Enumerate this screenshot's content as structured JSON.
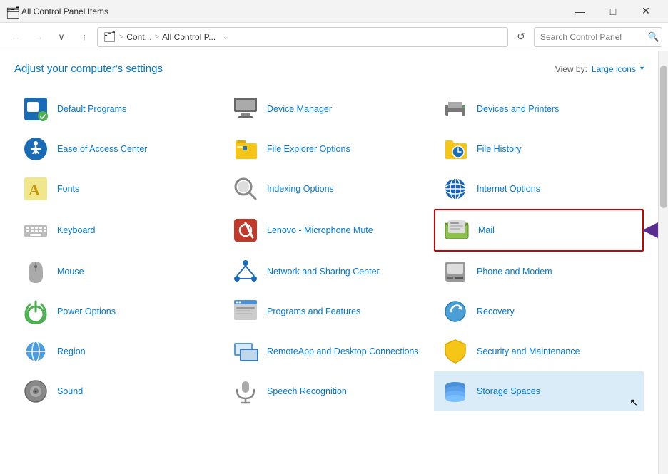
{
  "titlebar": {
    "title": "All Control Panel Items",
    "icon": "📋",
    "min_btn": "—",
    "max_btn": "□",
    "close_btn": "✕"
  },
  "addressbar": {
    "back_btn": "←",
    "forward_btn": "→",
    "dropdown_btn": "∨",
    "up_btn": "↑",
    "breadcrumb_1": "Cont...",
    "breadcrumb_2": "All Control P...",
    "dropdown_chevron": "⌄",
    "refresh": "↺",
    "search_placeholder": "Search Control Panel"
  },
  "header": {
    "title": "Adjust your computer's settings",
    "view_by_label": "View by:",
    "view_by_value": "Large icons",
    "view_by_arrow": "▾"
  },
  "items": [
    {
      "id": "default-programs",
      "label": "Default Programs",
      "icon": "default_programs"
    },
    {
      "id": "device-manager",
      "label": "Device Manager",
      "icon": "device_manager"
    },
    {
      "id": "devices-and-printers",
      "label": "Devices and Printers",
      "icon": "devices_printers"
    },
    {
      "id": "ease-of-access",
      "label": "Ease of Access Center",
      "icon": "ease_access"
    },
    {
      "id": "file-explorer-options",
      "label": "File Explorer Options",
      "icon": "file_explorer"
    },
    {
      "id": "file-history",
      "label": "File History",
      "icon": "file_history"
    },
    {
      "id": "fonts",
      "label": "Fonts",
      "icon": "fonts"
    },
    {
      "id": "indexing-options",
      "label": "Indexing Options",
      "icon": "indexing"
    },
    {
      "id": "internet-options",
      "label": "Internet Options",
      "icon": "internet_options"
    },
    {
      "id": "keyboard",
      "label": "Keyboard",
      "icon": "keyboard"
    },
    {
      "id": "lenovo-microphone",
      "label": "Lenovo - Microphone Mute",
      "icon": "lenovo_mic"
    },
    {
      "id": "mail",
      "label": "Mail",
      "icon": "mail",
      "highlighted": true
    },
    {
      "id": "mouse",
      "label": "Mouse",
      "icon": "mouse"
    },
    {
      "id": "network-sharing",
      "label": "Network and Sharing Center",
      "icon": "network"
    },
    {
      "id": "phone-modem",
      "label": "Phone and Modem",
      "icon": "phone_modem"
    },
    {
      "id": "power-options",
      "label": "Power Options",
      "icon": "power"
    },
    {
      "id": "programs-features",
      "label": "Programs and Features",
      "icon": "programs"
    },
    {
      "id": "recovery",
      "label": "Recovery",
      "icon": "recovery"
    },
    {
      "id": "region",
      "label": "Region",
      "icon": "region"
    },
    {
      "id": "remoteapp",
      "label": "RemoteApp and Desktop Connections",
      "icon": "remoteapp"
    },
    {
      "id": "security-maintenance",
      "label": "Security and Maintenance",
      "icon": "security"
    },
    {
      "id": "sound",
      "label": "Sound",
      "icon": "sound"
    },
    {
      "id": "speech-recognition",
      "label": "Speech Recognition",
      "icon": "speech"
    },
    {
      "id": "storage-spaces",
      "label": "Storage Spaces",
      "icon": "storage",
      "selected": true
    }
  ],
  "icons": {
    "default_programs": "🟦",
    "device_manager": "🖨",
    "devices_printers": "🖨",
    "ease_access": "🔵",
    "file_explorer": "📁",
    "file_history": "🕐",
    "fonts": "🅰",
    "indexing": "🔍",
    "internet_options": "🌐",
    "keyboard": "⌨",
    "lenovo_mic": "🎤",
    "mail": "📬",
    "mouse": "🖱",
    "network": "🌐",
    "phone_modem": "📠",
    "power": "⚡",
    "programs": "📋",
    "recovery": "🔄",
    "region": "🌍",
    "remoteapp": "🖥",
    "security": "🚩",
    "sound": "🔊",
    "speech": "🎙",
    "storage": "💾"
  }
}
